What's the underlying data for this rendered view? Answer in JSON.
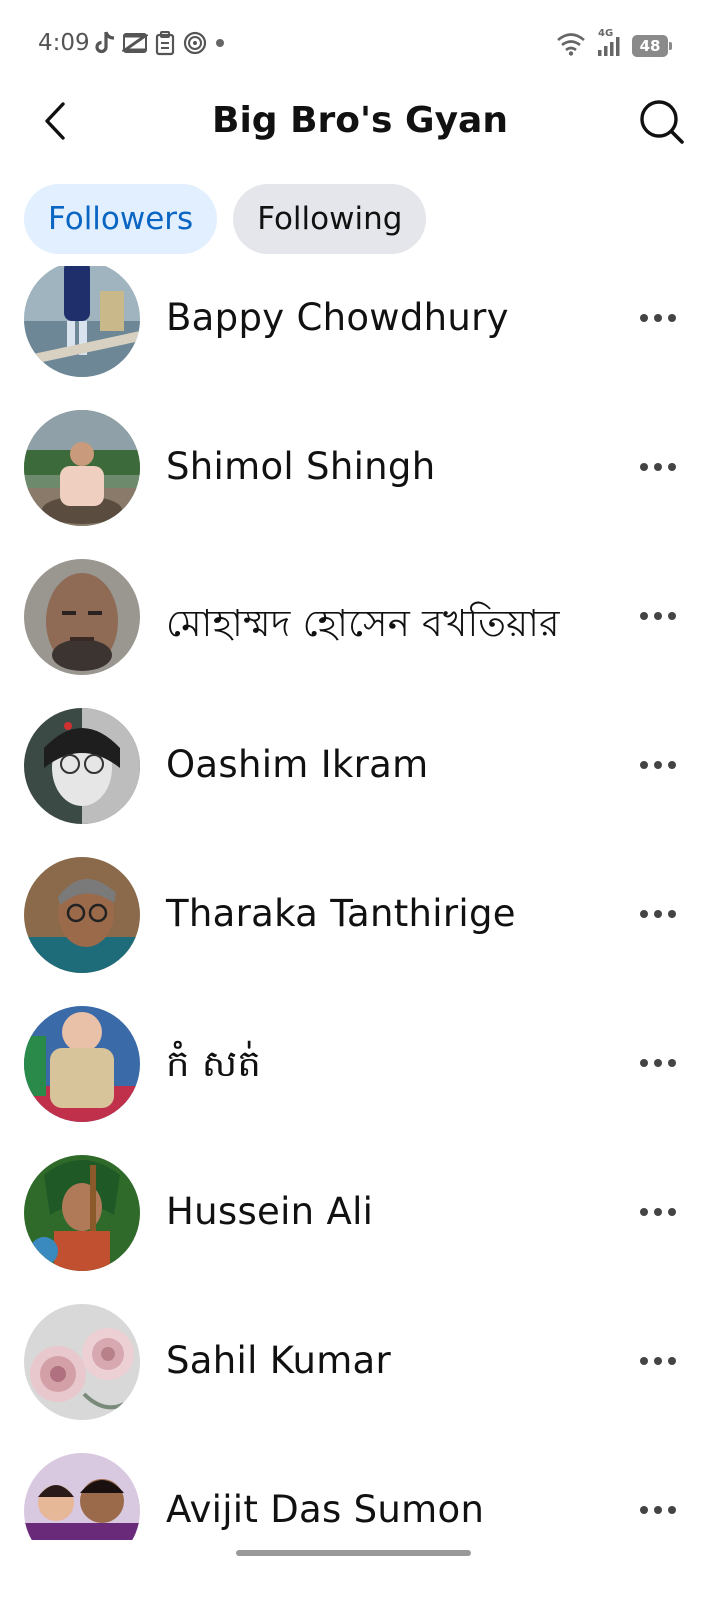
{
  "status_bar": {
    "time": "4:09",
    "network": "4G",
    "battery": "48",
    "left_icons": [
      "tiktok-icon",
      "capcut-icon",
      "clipboard-icon",
      "spiral-icon",
      "dot-icon"
    ],
    "right_icons": [
      "wifi-icon",
      "signal-icon",
      "battery-icon"
    ]
  },
  "header": {
    "title": "Big Bro's Gyan",
    "back_icon": "chevron-left-icon",
    "search_icon": "search-icon"
  },
  "tabs": [
    {
      "label": "Followers",
      "active": true
    },
    {
      "label": "Following",
      "active": false
    }
  ],
  "people": [
    {
      "name": "Bappy Chowdhury"
    },
    {
      "name": "Shimol Shingh"
    },
    {
      "name": "মোহাম্মদ হোসেন বখতিয়ার"
    },
    {
      "name": "Oashim Ikram"
    },
    {
      "name": "Tharaka Tanthirige"
    },
    {
      "name": "កំ សត់"
    },
    {
      "name": "Hussein Ali"
    },
    {
      "name": "Sahil Kumar"
    },
    {
      "name": "Avijit Das Sumon"
    }
  ],
  "colors": {
    "accent": "#0a66c2",
    "active_tab_bg": "#e1efff",
    "inactive_tab_bg": "#e4e6eb"
  }
}
